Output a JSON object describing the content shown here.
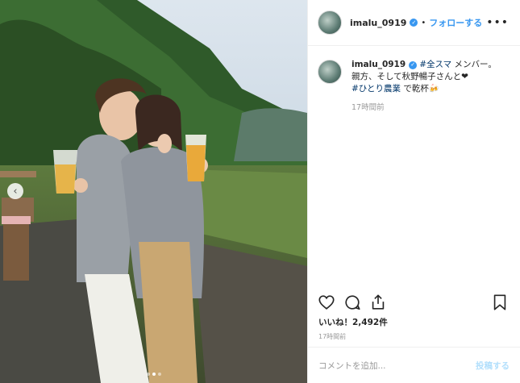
{
  "header": {
    "username": "imalu_0919",
    "separator": "•",
    "follow_label": "フォローする",
    "more_label": "•••"
  },
  "caption": {
    "username": "imalu_0919",
    "hashtag1": "#全スマ",
    "text1": " メンバー。",
    "line2": "親方、そして秋野暢子さんと❤",
    "hashtag2": "#ひとり農業",
    "text2": " で乾杯",
    "emoji": "🍻",
    "time": "17時間前"
  },
  "actions": {
    "icons": [
      "heart-icon",
      "comment-icon",
      "share-icon",
      "bookmark-icon"
    ]
  },
  "likes": {
    "label": "いいね！",
    "count": "2,492件"
  },
  "post_time": "17時間前",
  "comment": {
    "placeholder": "コメントを追加...",
    "post_label": "投稿する"
  },
  "carousel": {
    "prev_icon": "‹",
    "current_index": 1,
    "total": 3
  },
  "colors": {
    "link_blue": "#3897f0",
    "hashtag": "#003569",
    "muted": "#999999",
    "post_disabled": "#b2dffc"
  }
}
